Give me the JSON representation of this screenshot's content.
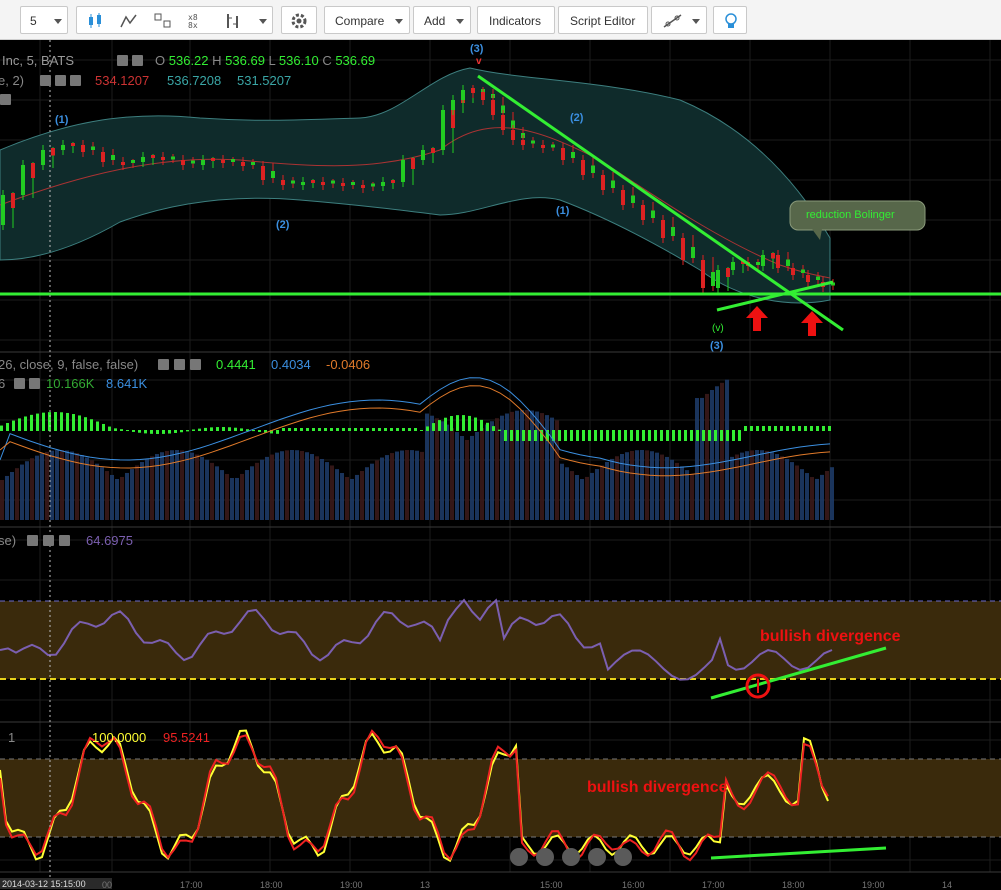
{
  "toolbar": {
    "interval_value": "5",
    "compare_label": "Compare",
    "add_label": "Add",
    "indicators_label": "Indicators",
    "script_editor_label": "Script Editor"
  },
  "legend": {
    "main": {
      "symbol": "Inc, 5, BATS",
      "o_label": "O",
      "o_value": "536.22",
      "h_label": "H",
      "h_value": "536.69",
      "l_label": "L",
      "l_value": "536.10",
      "c_label": "C",
      "c_value": "536.69"
    },
    "bollinger": {
      "params": "e, 2)",
      "v1": "534.1207",
      "v2": "536.7208",
      "v3": "531.5207"
    },
    "macd": {
      "params": "26, close, 9, false, false)",
      "v1": "0.4441",
      "v2": "0.4034",
      "v3": "-0.0406"
    },
    "volume": {
      "params": "6",
      "v1": "10.166K",
      "v2": "8.641K"
    },
    "rsi": {
      "params": "se)",
      "v1": "64.6975"
    },
    "stoch": {
      "params": "1",
      "v1": "100.0000",
      "v2": "95.5241"
    }
  },
  "annotations": {
    "reduction_bollinger": "reduction Bolinger",
    "bullish_divergence_rsi": "bullish divergence",
    "bullish_divergence_stoch": "bullish divergence"
  },
  "wave_labels": {
    "w_3_top": "(3)",
    "w_v_top": "v",
    "w_1a": "(1)",
    "w_2a": "(2)",
    "w_1b": "(1)",
    "w_2b": "(2)",
    "w_3_bottom": "(3)",
    "w_v_bottom": "(v)"
  },
  "xaxis": {
    "cursor_label": "2014-03-12 15:15:00",
    "ticks": [
      "00",
      "17:00",
      "18:00",
      "19:00",
      "13",
      "15:00",
      "16:00",
      "17:00",
      "18:00",
      "19:00",
      "14"
    ]
  },
  "colors": {
    "green_line": "#33ee33",
    "red_arrow": "#ee1111",
    "rsi_band": "#3a2a0c",
    "price_up": "#22cc22",
    "price_down": "#dd2222"
  },
  "icons": [
    "candles-icon",
    "bars-icon",
    "line-chart-icon",
    "heikin-ashi-icon",
    "settings-icon",
    "drawing-tools-icon",
    "lightbulb-icon"
  ]
}
